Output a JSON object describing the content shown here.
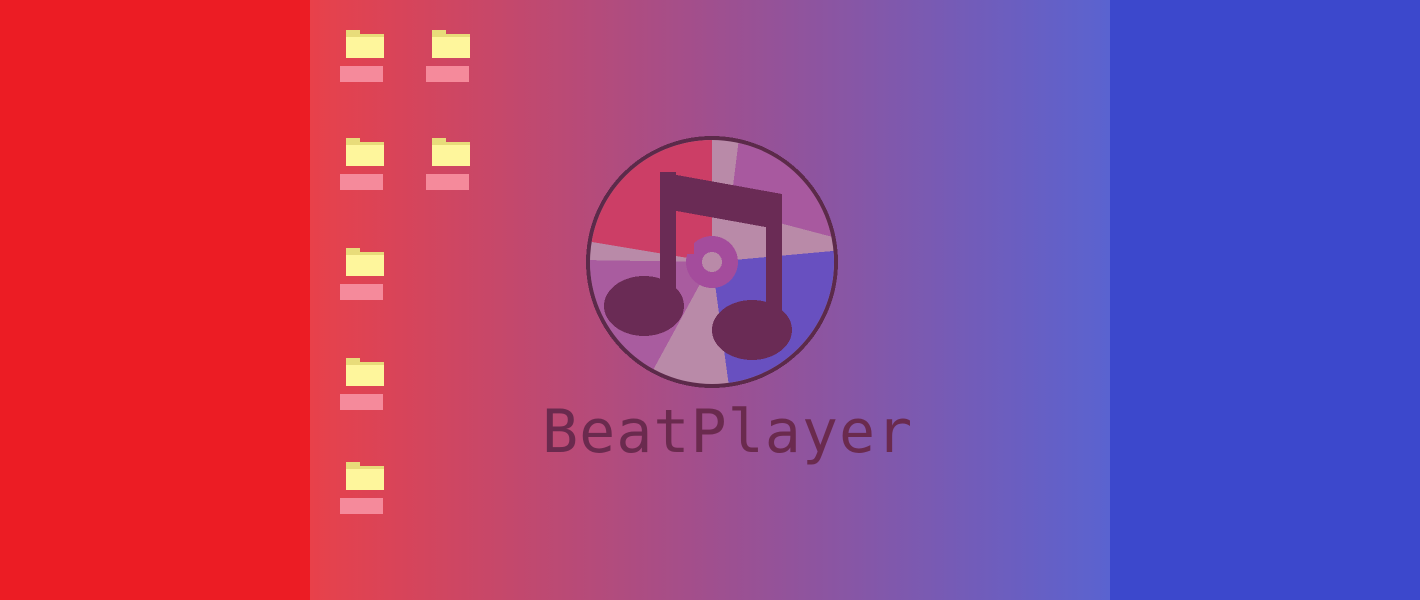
{
  "colors": {
    "left_panel": "#ec1c24",
    "right_panel": "#3c48cc",
    "gradient_start": "#e8414a",
    "gradient_mid": "#a04f8e",
    "gradient_end": "#5a63d0",
    "folder": "#fef69c",
    "folder_shadow": "#e8dc7a",
    "label_background": "#f58a9b",
    "logo_text": "#6a2a4e",
    "disc_outline": "#5c2a4a",
    "disc_light": "#b98aa8",
    "disc_pink": "#cc3e66",
    "disc_violet": "#a44c9c",
    "disc_blue": "#6850c0",
    "note_dark": "#6a2b55"
  },
  "desktop_icons": [
    {
      "icon": "folder-icon",
      "label": ""
    },
    {
      "icon": "folder-icon",
      "label": ""
    },
    {
      "icon": "folder-icon",
      "label": ""
    },
    {
      "icon": "folder-icon",
      "label": ""
    },
    {
      "icon": "folder-icon",
      "label": ""
    },
    {
      "icon": "folder-icon",
      "label": ""
    },
    {
      "icon": "folder-icon",
      "label": ""
    }
  ],
  "logo": {
    "icon": "music-note-disc-icon",
    "title": "BeatPlayer"
  }
}
